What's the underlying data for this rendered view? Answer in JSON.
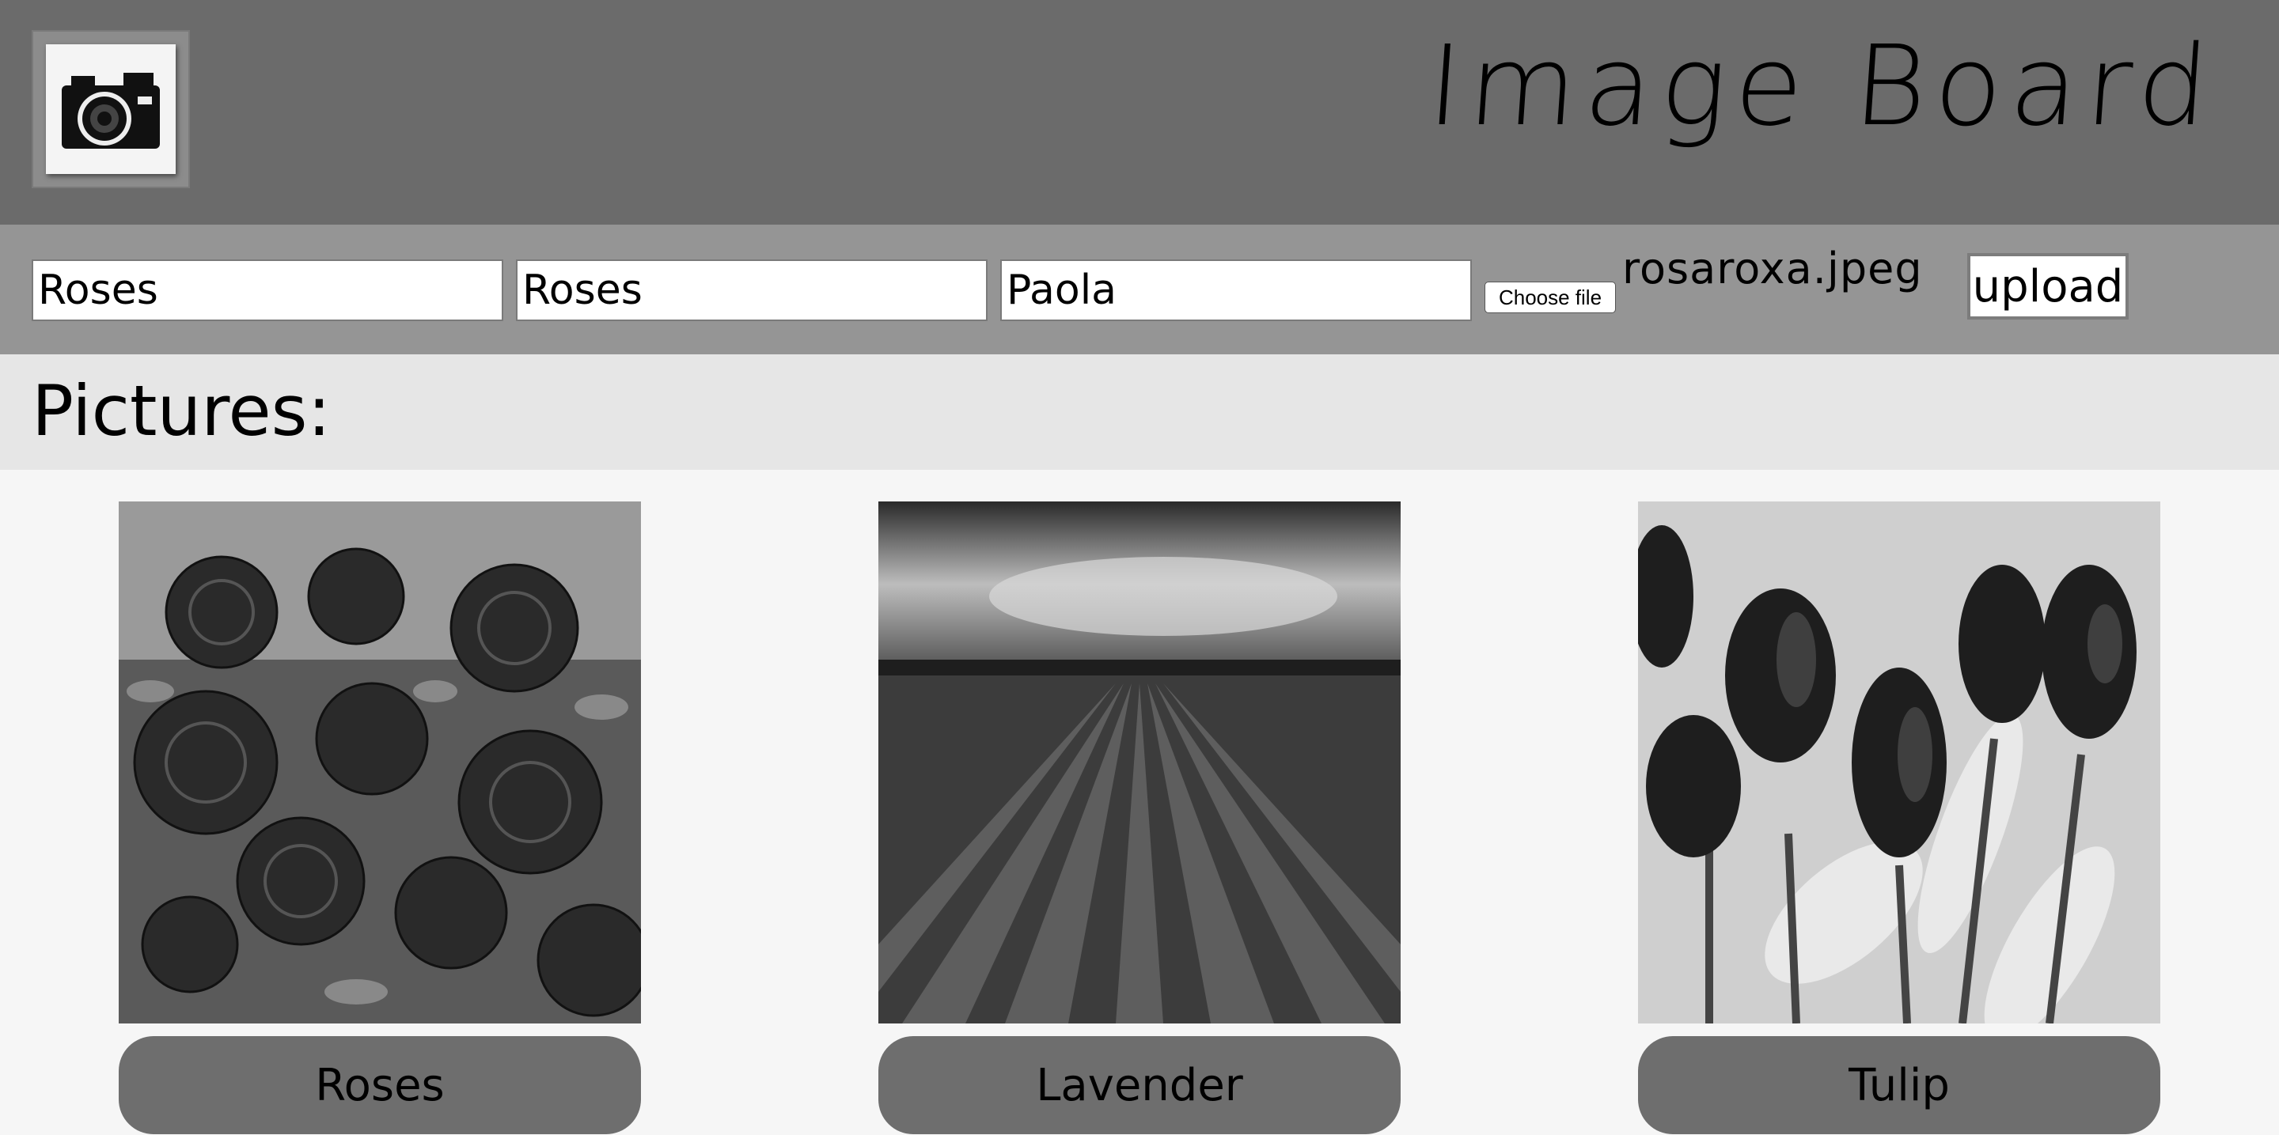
{
  "header": {
    "title": "Image Board",
    "logo_icon": "camera-icon"
  },
  "form": {
    "field1_value": "Roses",
    "field2_value": "Roses",
    "field3_value": "Paola",
    "choose_file_label": "Choose file",
    "selected_file": "rosaroxa.jpeg",
    "upload_label": "upload"
  },
  "pictures": {
    "heading": "Pictures:",
    "items": [
      {
        "label": "Roses"
      },
      {
        "label": "Lavender"
      },
      {
        "label": "Tulip"
      }
    ]
  }
}
